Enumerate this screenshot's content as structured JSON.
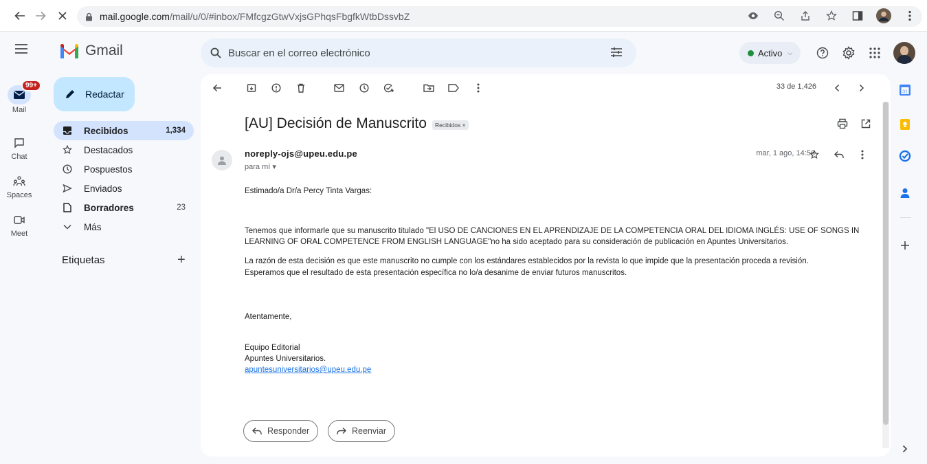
{
  "browser": {
    "url_host": "mail.google.com",
    "url_path": "/mail/u/0/#inbox/FMfcgzGtwVxjsGPhqsFbgfkWtbDssvbZ"
  },
  "app": {
    "name": "Gmail"
  },
  "search": {
    "placeholder": "Buscar en el correo electrónico"
  },
  "status": {
    "label": "Activo",
    "color": "#1e8e3e"
  },
  "rail": {
    "mail": {
      "label": "Mail",
      "badge": "99+"
    },
    "chat": {
      "label": "Chat"
    },
    "spaces": {
      "label": "Spaces"
    },
    "meet": {
      "label": "Meet"
    }
  },
  "sidebar": {
    "compose_label": "Redactar",
    "items": [
      {
        "label": "Recibidos",
        "count": "1,334",
        "icon": "inbox-icon"
      },
      {
        "label": "Destacados",
        "count": "",
        "icon": "star-icon"
      },
      {
        "label": "Pospuestos",
        "count": "",
        "icon": "clock-icon"
      },
      {
        "label": "Enviados",
        "count": "",
        "icon": "send-icon"
      },
      {
        "label": "Borradores",
        "count": "23",
        "icon": "draft-icon"
      },
      {
        "label": "Más",
        "count": "",
        "icon": "chevron-down-icon"
      }
    ],
    "labels_heading": "Etiquetas"
  },
  "toolbar": {
    "pager": "33 de 1,426"
  },
  "message": {
    "subject": "[AU] Decisión de Manuscrito",
    "label_tag": "Recibidos ×",
    "sender": "noreply-ojs@upeu.edu.pe",
    "to": "para mí ▾",
    "date": "mar, 1 ago, 14:56",
    "greeting": "Estimado/a Dr/a Percy Tinta Vargas:",
    "para1_line1": "Tenemos que informarle  que su manuscrito titulado \"El USO DE CANCIONES EN EL APRENDIZAJE DE LA COMPETENCIA ORAL DEL IDIOMA INGLÉS: USE OF SONGS IN",
    "para1_line2": "LEARNING OF ORAL COMPETENCE FROM ENGLISH LANGUAGE\"no ha sido aceptado para su consideración de publicación en Apuntes Universitarios.",
    "para2_line1": "La razón de esta decisión es que este manuscrito no cumple con los estándares establecidos por la revista lo que impide que la presentación proceda a revisión.",
    "para2_line2": "Esperamos que el resultado de esta presentación específica no lo/a desanime de enviar futuros manuscritos.",
    "closing": "Atentamente,",
    "sig_line1": "Equipo Editorial",
    "sig_line2": "Apuntes Universitarios.",
    "sig_email": "apuntesuniversitarios@upeu.edu.pe"
  },
  "actions": {
    "reply": "Responder",
    "forward": "Reenviar"
  },
  "colors": {
    "accent": "#1a73e8",
    "compose_bg": "#c2e7ff",
    "active_bg": "#d3e3fd",
    "badge": "#c5221f"
  }
}
